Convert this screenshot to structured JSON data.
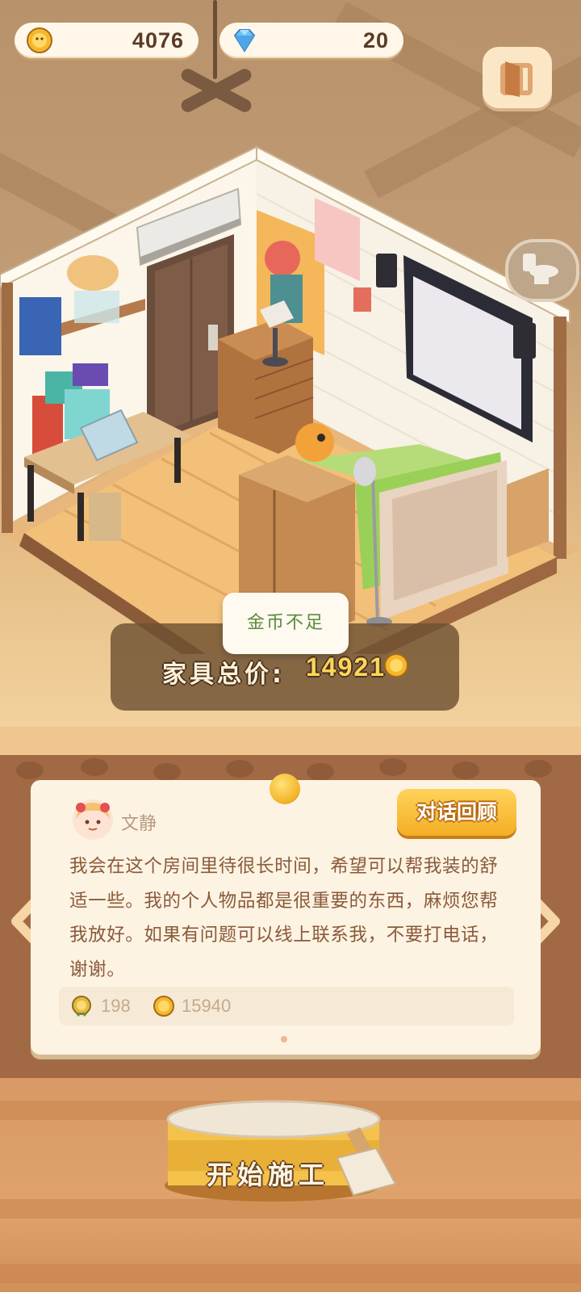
{
  "resources": {
    "coins": "4076",
    "gems": "20"
  },
  "scene": {
    "price_label": "家具总价:",
    "price_value": "14921",
    "toast_text": "金币不足"
  },
  "npc": {
    "name": "文静",
    "review_button": "对话回顾",
    "message": "我会在这个房间里待很长时间，希望可以帮我装的舒适一些。我的个人物品都是很重要的东西，麻烦您帮我放好。如果有问题可以线上联系我，不要打电话，谢谢。",
    "rewards": {
      "experience": "198",
      "coins": "15940"
    }
  },
  "actions": {
    "start_build": "开始施工"
  },
  "colors": {
    "accent_gold": "#f4ae25",
    "toast_text": "#5c8a3c",
    "board_brown": "#a26a44"
  },
  "icons": {
    "coin": "lion-coin-icon",
    "gem": "diamond-icon",
    "exit": "door-exit-icon",
    "side": "toilet-icon",
    "nav_prev": "chevron-left-icon",
    "nav_next": "chevron-right-icon",
    "experience": "medal-icon",
    "brush": "paint-brush-icon"
  }
}
